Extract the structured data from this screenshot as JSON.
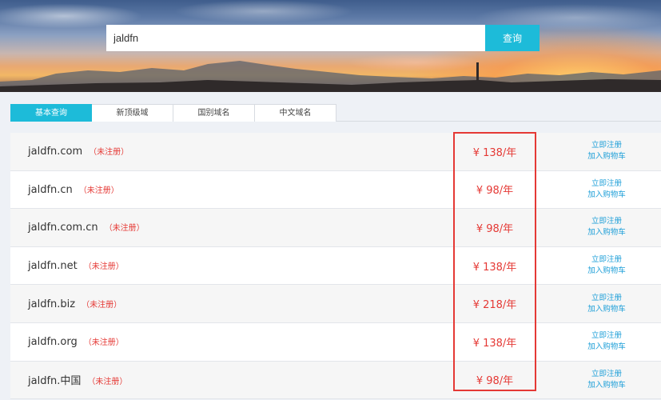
{
  "search": {
    "value": "jaldfn",
    "button_label": "查询"
  },
  "tabs": [
    {
      "label": "基本查询",
      "active": true
    },
    {
      "label": "新顶级域",
      "active": false
    },
    {
      "label": "国别域名",
      "active": false
    },
    {
      "label": "中文域名",
      "active": false
    }
  ],
  "results": [
    {
      "domain": "jaldfn.com",
      "status": "（未注册）",
      "price": "¥ 138/年",
      "register": "立即注册",
      "cart": "加入购物车"
    },
    {
      "domain": "jaldfn.cn",
      "status": "（未注册）",
      "price": "¥ 98/年",
      "register": "立即注册",
      "cart": "加入购物车"
    },
    {
      "domain": "jaldfn.com.cn",
      "status": "（未注册）",
      "price": "¥ 98/年",
      "register": "立即注册",
      "cart": "加入购物车"
    },
    {
      "domain": "jaldfn.net",
      "status": "（未注册）",
      "price": "¥ 138/年",
      "register": "立即注册",
      "cart": "加入购物车"
    },
    {
      "domain": "jaldfn.biz",
      "status": "（未注册）",
      "price": "¥ 218/年",
      "register": "立即注册",
      "cart": "加入购物车"
    },
    {
      "domain": "jaldfn.org",
      "status": "（未注册）",
      "price": "¥ 138/年",
      "register": "立即注册",
      "cart": "加入购物车"
    },
    {
      "domain": "jaldfn.中国",
      "status": "（未注册）",
      "price": "¥ 98/年",
      "register": "立即注册",
      "cart": "加入购物车"
    }
  ],
  "colors": {
    "accent": "#1dbbd9",
    "price": "#e53935",
    "link": "#1e9fd8",
    "highlight": "#e53935"
  }
}
